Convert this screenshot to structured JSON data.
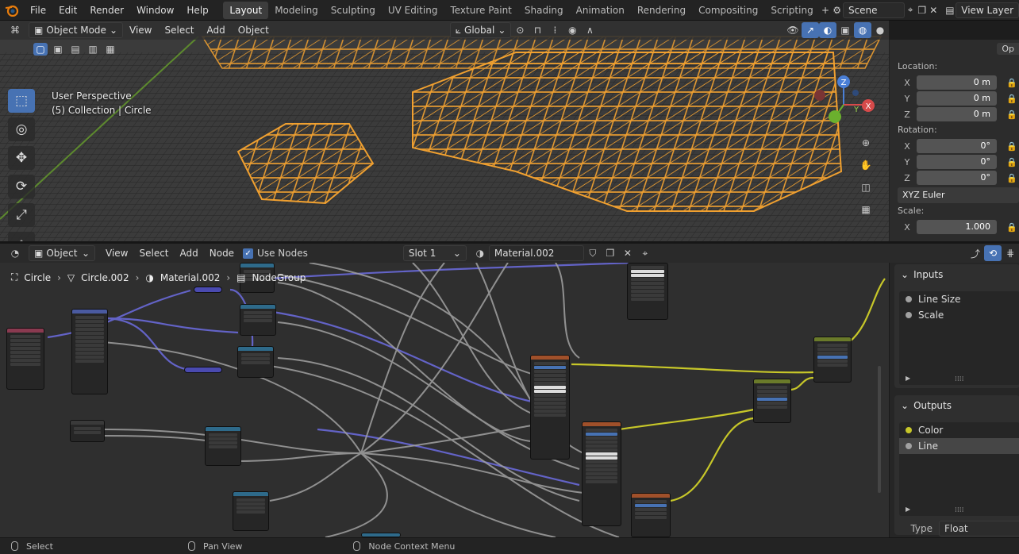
{
  "topbar": {
    "menu": [
      "File",
      "Edit",
      "Render",
      "Window",
      "Help"
    ],
    "workspaces": [
      "Layout",
      "Modeling",
      "Sculpting",
      "UV Editing",
      "Texture Paint",
      "Shading",
      "Animation",
      "Rendering",
      "Compositing",
      "Scripting"
    ],
    "active_workspace": "Layout",
    "scene": "Scene",
    "view_layer": "View Layer"
  },
  "viewport": {
    "mode": "Object Mode",
    "menu": [
      "View",
      "Select",
      "Add",
      "Object"
    ],
    "transform_orientation": "Global",
    "perspective": "User Perspective",
    "collection_info": "(5) Collection | Circle",
    "options_label": "Op",
    "gizmo_axes": {
      "x": "X",
      "y": "Y",
      "z": "Z"
    }
  },
  "npanel": {
    "location_label": "Location:",
    "location": {
      "x": "0 m",
      "y": "0 m",
      "z": "0 m"
    },
    "rotation_label": "Rotation:",
    "rotation": {
      "x": "0°",
      "y": "0°",
      "z": "0°"
    },
    "rotation_mode": "XYZ Euler",
    "scale_label": "Scale:",
    "scale": {
      "x": "1.000"
    },
    "axes": {
      "x": "X",
      "y": "Y",
      "z": "Z"
    }
  },
  "node_editor": {
    "editor_type": "Object",
    "menu": [
      "View",
      "Select",
      "Add",
      "Node"
    ],
    "use_nodes_label": "Use Nodes",
    "use_nodes": true,
    "slot": "Slot 1",
    "material": "Material.002",
    "breadcrumb": [
      "Circle",
      "Circle.002",
      "Material.002",
      "NodeGroup"
    ]
  },
  "group_sidebar": {
    "inputs_title": "Inputs",
    "inputs": [
      "Line Size",
      "Scale"
    ],
    "outputs_title": "Outputs",
    "outputs": [
      {
        "name": "Color",
        "socket": "yellow"
      },
      {
        "name": "Line",
        "socket": "gray"
      }
    ],
    "selected_output": "Line",
    "type_label": "Type",
    "type_value": "Float"
  },
  "statusbar": {
    "items": [
      "Select",
      "Pan View",
      "Node Context Menu"
    ]
  },
  "colors": {
    "accent": "#4772b3",
    "wire_orange": "#f0a030",
    "link_purple": "#6363c7",
    "link_gray": "#a1a1a1",
    "link_yellow": "#c7c729",
    "header_green": "#c7c729"
  }
}
